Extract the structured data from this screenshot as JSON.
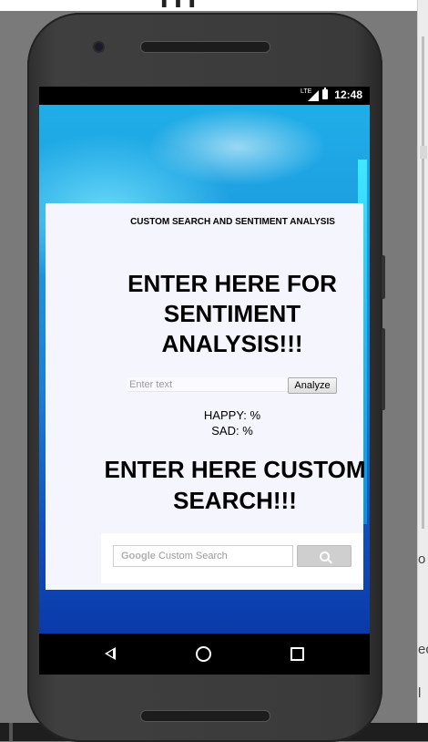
{
  "statusbar": {
    "network": "LTE",
    "time": "12:48"
  },
  "app": {
    "title": "CUSTOM SEARCH AND SENTIMENT ANALYSIS",
    "sentiment_heading": "ENTER HERE FOR SENTIMENT ANALYSIS!!!",
    "input_placeholder": "Enter text",
    "input_value": "",
    "analyze_label": "Analyze",
    "happy_label": "HAPPY: %",
    "sad_label": "SAD: %",
    "search_heading": "ENTER HERE CUSTOM SEARCH!!!",
    "gcse_brand": "Google",
    "gcse_placeholder": "Custom Search"
  },
  "navbar": {
    "icons": [
      "back-icon",
      "home-icon",
      "recent-apps-icon"
    ]
  },
  "background_fragments": {
    "right_top": "o",
    "right_middle": "ec",
    "right_bottom": "l"
  },
  "colors": {
    "card": "#f4f5fd",
    "accent": "#1e9fe0",
    "button": "#cfcfcf"
  }
}
